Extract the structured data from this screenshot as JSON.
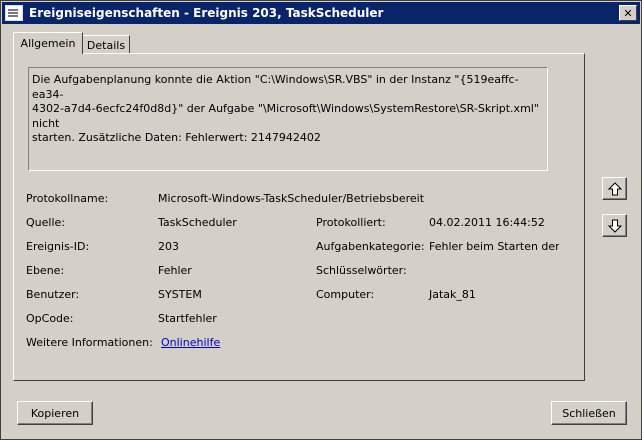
{
  "window": {
    "title": "Ereigniseigenschaften - Ereignis 203, TaskScheduler"
  },
  "tabs": [
    {
      "label": "Allgemein"
    },
    {
      "label": "Details"
    }
  ],
  "description": "Die Aufgabenplanung konnte die Aktion \"C:\\Windows\\SR.VBS\" in der Instanz \"{519eaffc-ea34-\n4302-a7d4-6ecfc24f0d8d}\" der Aufgabe \"\\Microsoft\\Windows\\SystemRestore\\SR-Skript.xml\" nicht\nstarten. Zusätzliche Daten: Fehlerwert: 2147942402",
  "fields": {
    "protokollname": {
      "label": "Protokollname:",
      "value": "Microsoft-Windows-TaskScheduler/Betriebsbereit"
    },
    "quelle": {
      "label": "Quelle:",
      "value": "TaskScheduler"
    },
    "protokolliert": {
      "label": "Protokolliert:",
      "value": "04.02.2011 16:44:52"
    },
    "ereignis_id": {
      "label": "Ereignis-ID:",
      "value": "203"
    },
    "aufgabenkategorie": {
      "label": "Aufgabenkategorie:",
      "value": "Fehler beim Starten der Aktion"
    },
    "ebene": {
      "label": "Ebene:",
      "value": "Fehler"
    },
    "schluesselwoerter": {
      "label": "Schlüsselwörter:",
      "value": ""
    },
    "benutzer": {
      "label": "Benutzer:",
      "value": "SYSTEM"
    },
    "computer": {
      "label": "Computer:",
      "value": "Jatak_81"
    },
    "opcode": {
      "label": "OpCode:",
      "value": "Startfehler"
    },
    "weitere": {
      "label": "Weitere Informationen:",
      "value": "Onlinehilfe"
    }
  },
  "buttons": {
    "copy": "Kopieren",
    "close": "Schließen"
  },
  "icons": {
    "up": "arrow-up-icon",
    "down": "arrow-down-icon",
    "close": "close-icon",
    "app": "event-viewer-icon"
  }
}
